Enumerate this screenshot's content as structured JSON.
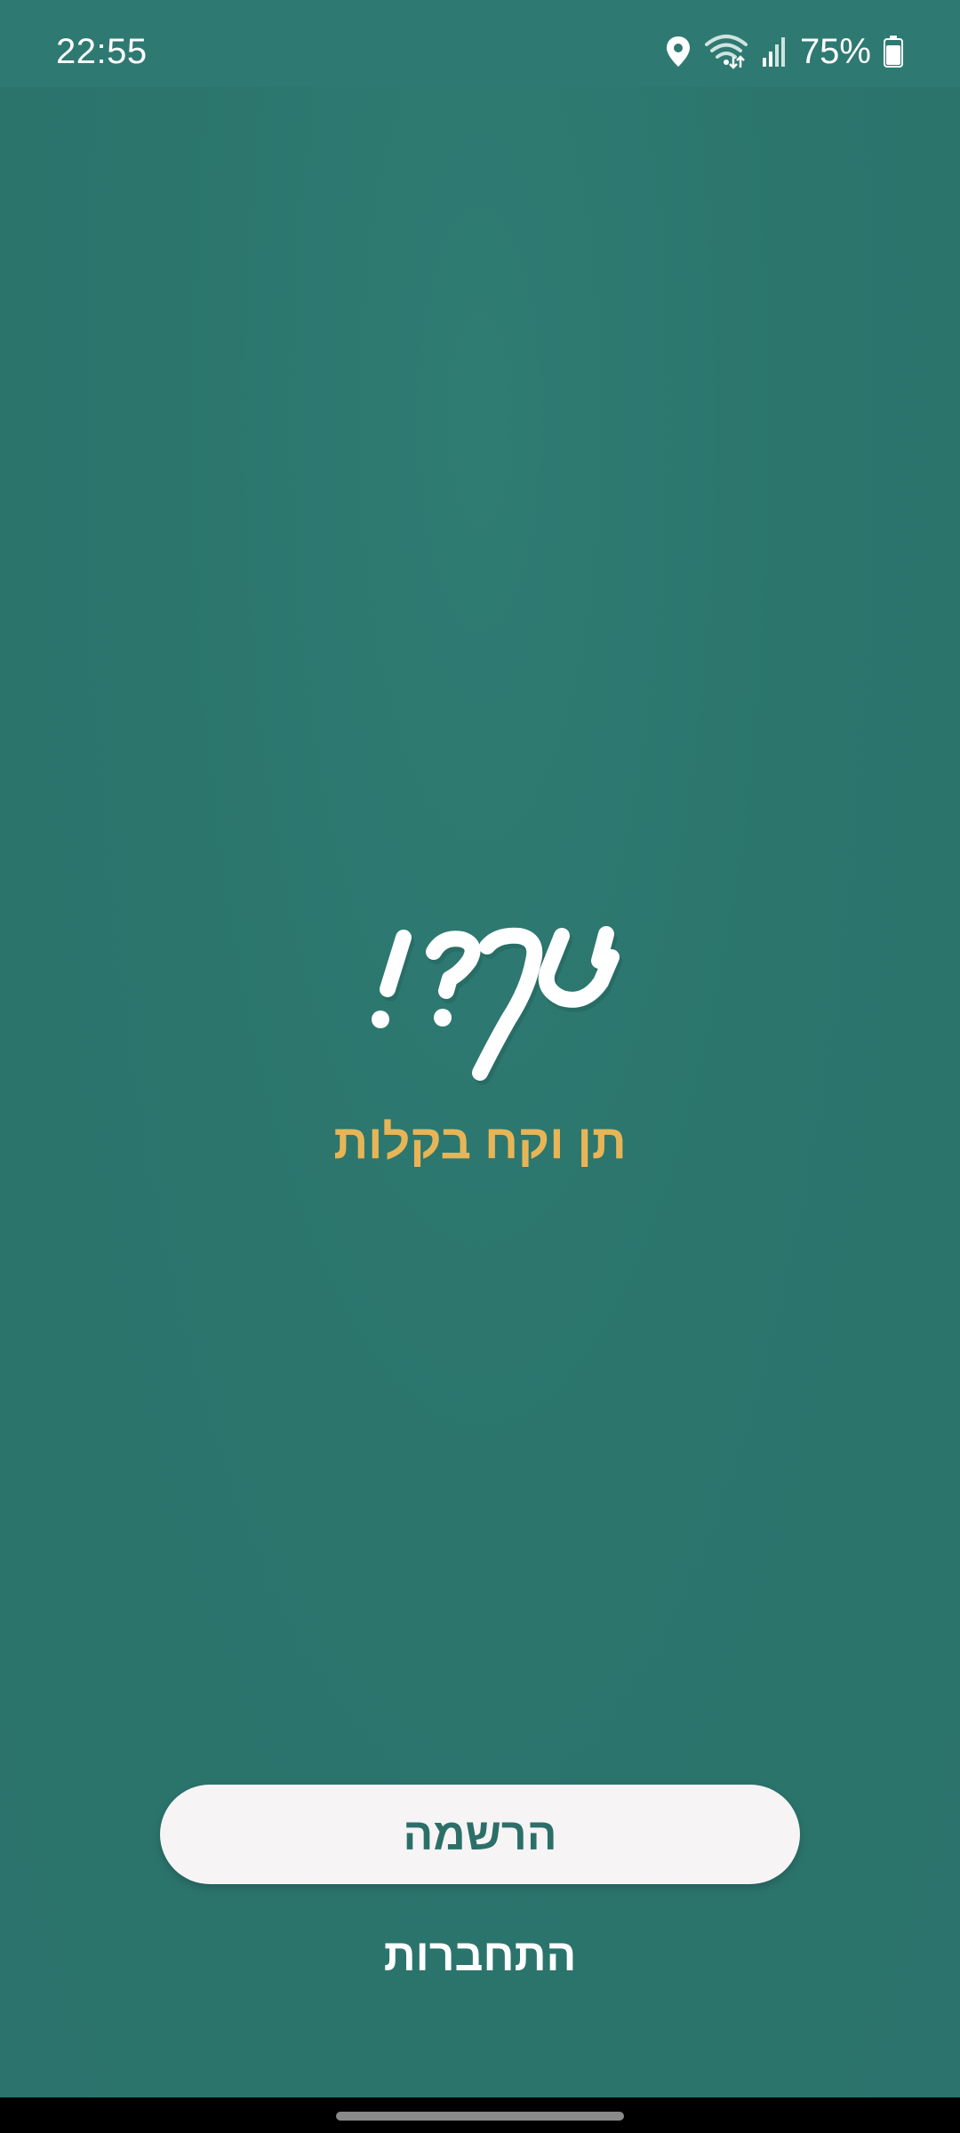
{
  "status_bar": {
    "time": "22:55",
    "battery_percent": "75%",
    "battery_level": 0.75,
    "icons": [
      "location-icon",
      "wifi-icon",
      "signal-icon",
      "battery-icon"
    ]
  },
  "splash": {
    "logo_text": "ישר?!",
    "tagline": "תן וקח בקלות"
  },
  "actions": {
    "register_label": "הרשמה",
    "login_label": "התחברות"
  },
  "colors": {
    "background": "#2c776f",
    "accent": "#e8b556",
    "button_bg": "#f6f4f4",
    "button_text": "#2c6f69"
  }
}
